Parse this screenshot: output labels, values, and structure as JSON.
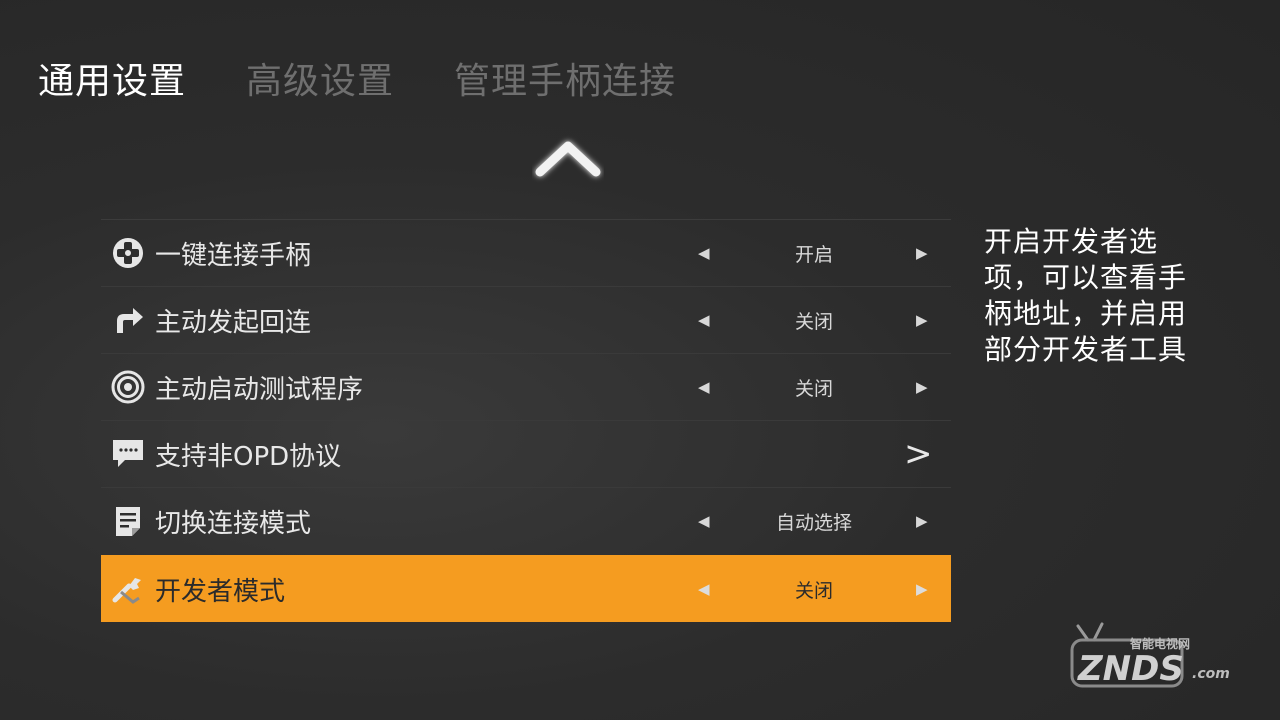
{
  "tabs": [
    {
      "label": "通用设置",
      "active": true
    },
    {
      "label": "高级设置",
      "active": false
    },
    {
      "label": "管理手柄连接",
      "active": false
    }
  ],
  "menu": [
    {
      "label": "一键连接手柄",
      "value": "开启",
      "icon": "gamepad-icon"
    },
    {
      "label": "主动发起回连",
      "value": "关闭",
      "icon": "reconnect-arrow-icon"
    },
    {
      "label": "主动启动测试程序",
      "value": "关闭",
      "icon": "target-icon"
    },
    {
      "label": "支持非OPD协议",
      "submenu": ">",
      "icon": "chat-bubble-icon"
    },
    {
      "label": "切换连接模式",
      "value": "自动选择",
      "icon": "document-icon"
    },
    {
      "label": "开发者模式",
      "value": "关闭",
      "icon": "wrench-icon",
      "selected": true
    }
  ],
  "description": "开启开发者选项，可以查看手柄地址，并启用部分开发者工具",
  "logo": {
    "top_text": "智能电视网",
    "main_text": "ZNDS",
    "suffix": ".com"
  },
  "colors": {
    "accent": "#f59c20",
    "background": "#2c2c2c",
    "tab_inactive": "#6f6f6f"
  }
}
